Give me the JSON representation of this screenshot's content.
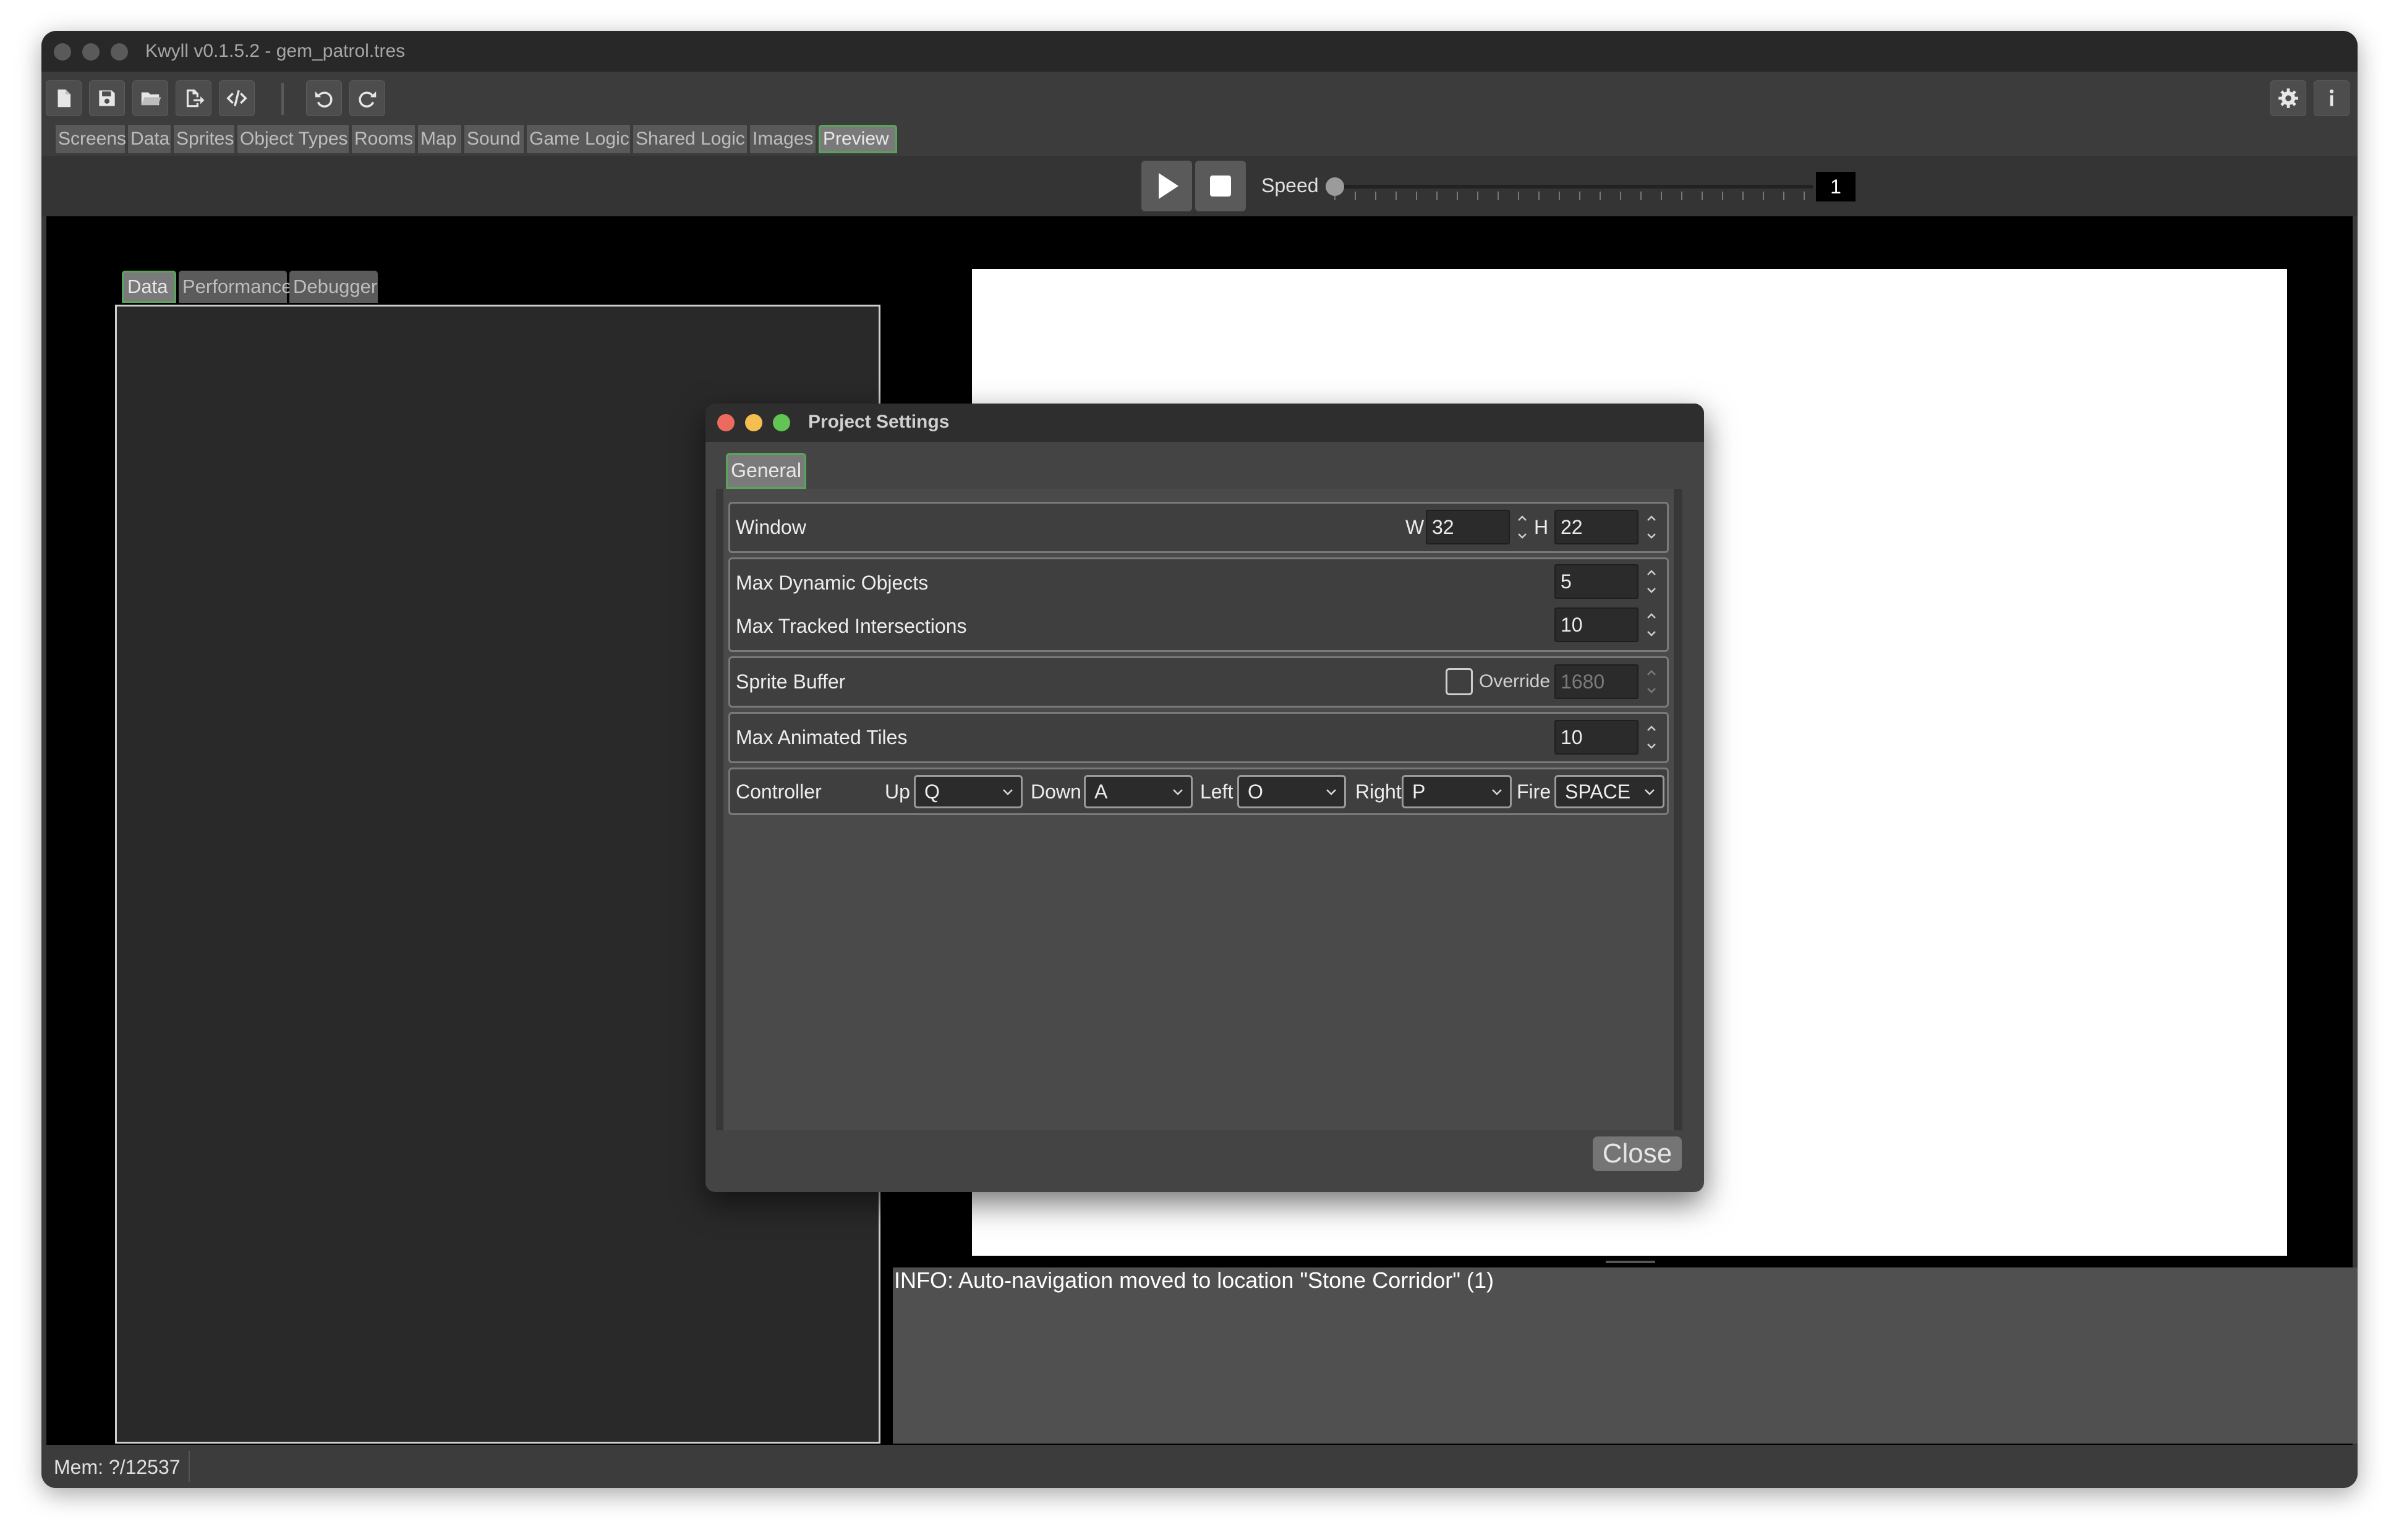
{
  "window": {
    "title": "Kwyll v0.1.5.2 - gem_patrol.tres"
  },
  "toolbar": {
    "icons": [
      "new-file-icon",
      "save-icon",
      "open-folder-icon",
      "export-icon",
      "code-icon",
      "undo-icon",
      "redo-icon",
      "settings-gear-icon",
      "info-icon"
    ]
  },
  "tabs": [
    {
      "label": "Screens"
    },
    {
      "label": "Data"
    },
    {
      "label": "Sprites"
    },
    {
      "label": "Object Types"
    },
    {
      "label": "Rooms"
    },
    {
      "label": "Map"
    },
    {
      "label": "Sound"
    },
    {
      "label": "Game Logic"
    },
    {
      "label": "Shared Logic"
    },
    {
      "label": "Images"
    },
    {
      "label": "Preview",
      "active": true
    }
  ],
  "playbar": {
    "speed_label": "Speed",
    "speed_value": "1"
  },
  "left_panel": {
    "tabs": [
      {
        "label": "Data",
        "active": true
      },
      {
        "label": "Performance"
      },
      {
        "label": "Debugger"
      }
    ]
  },
  "console": {
    "message": "INFO: Auto-navigation moved to location \"Stone Corridor\" (1)"
  },
  "status": {
    "mem": "Mem: ?/12537"
  },
  "dialog": {
    "title": "Project Settings",
    "tab": "General",
    "window_label": "Window",
    "w_label": "W",
    "w_value": "32",
    "h_label": "H",
    "h_value": "22",
    "max_dynamic_objects_label": "Max Dynamic Objects",
    "max_dynamic_objects_value": "5",
    "max_tracked_label": "Max Tracked Intersections",
    "max_tracked_value": "10",
    "sprite_buffer_label": "Sprite Buffer",
    "override_label": "Override",
    "sprite_buffer_value": "1680",
    "override_checked": false,
    "max_animated_label": "Max Animated Tiles",
    "max_animated_value": "10",
    "controller_label": "Controller",
    "up_label": "Up",
    "up_value": "Q",
    "down_label": "Down",
    "down_value": "A",
    "left_label": "Left",
    "left_value": "O",
    "right_label": "Right",
    "right_value": "P",
    "fire_label": "Fire",
    "fire_value": "SPACE",
    "close_label": "Close"
  },
  "colors": {
    "accent_green": "#57a55a",
    "close_red": "#ed6a5e",
    "minimize_yellow": "#f5bf4f",
    "maximize_green": "#61c554"
  }
}
